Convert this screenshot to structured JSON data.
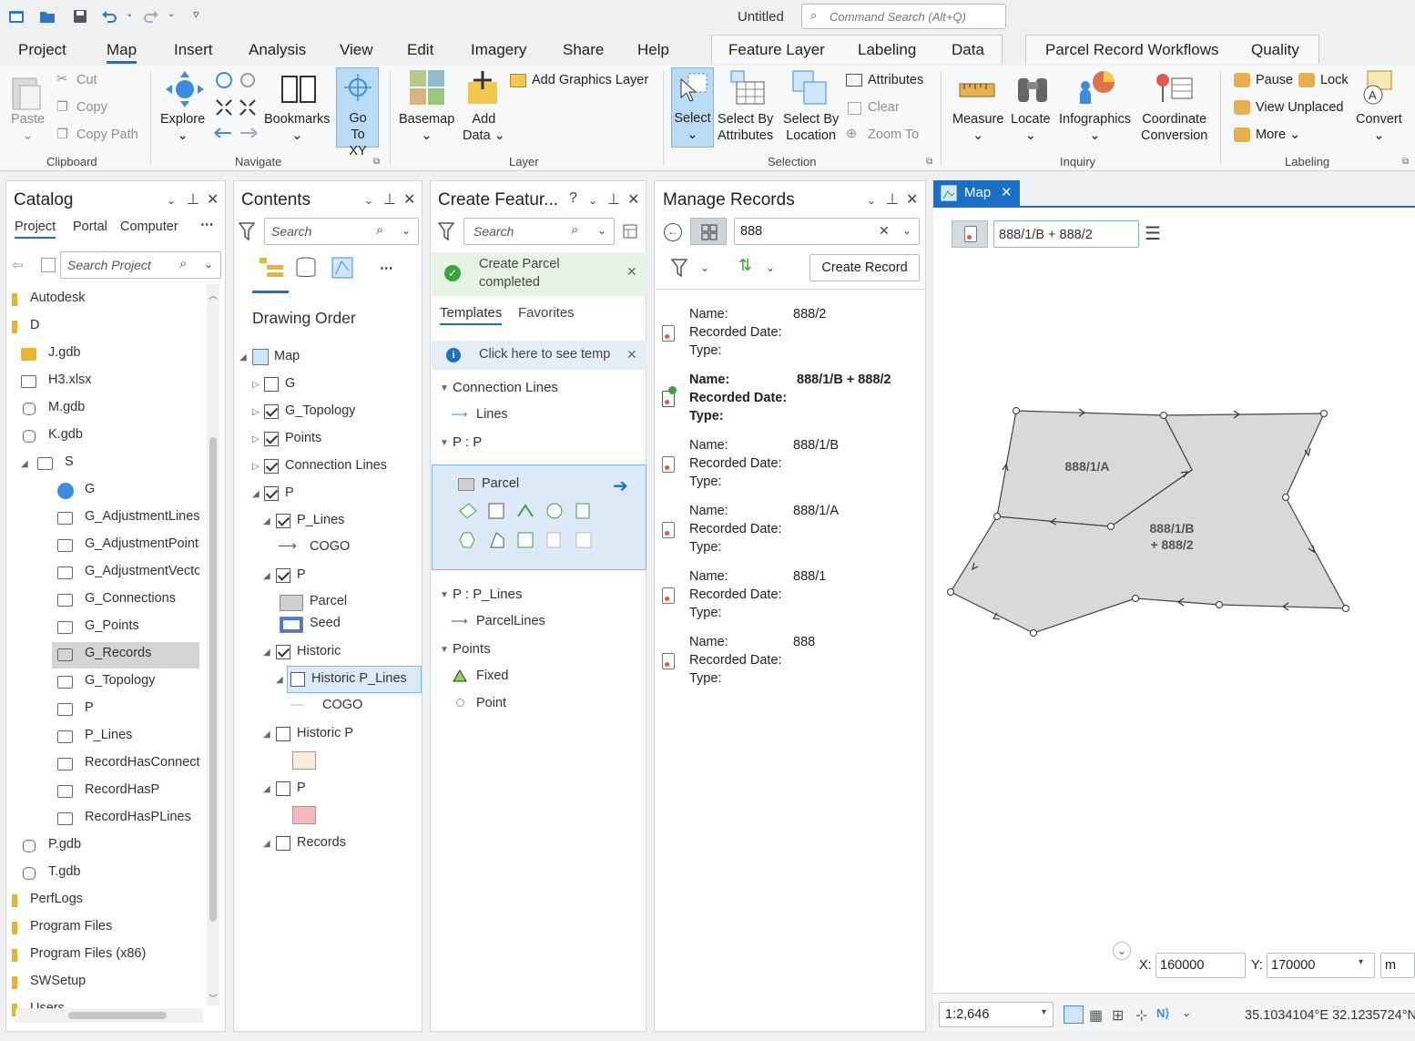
{
  "title_bar": {
    "doc_title": "Untitled",
    "command_search_placeholder": "Command Search (Alt+Q)"
  },
  "tabs": [
    "Project",
    "Map",
    "Insert",
    "Analysis",
    "View",
    "Edit",
    "Imagery",
    "Share",
    "Help"
  ],
  "context_tabs": [
    "Feature Layer",
    "Labeling",
    "Data"
  ],
  "context_tabs2": [
    "Parcel Record Workflows",
    "Quality"
  ],
  "ribbon": {
    "clipboard": {
      "paste": "Paste",
      "cut": "Cut",
      "copy": "Copy",
      "copy_path": "Copy Path",
      "group": "Clipboard"
    },
    "navigate": {
      "explore": "Explore",
      "bookmarks": "Bookmarks",
      "goto1": "Go",
      "goto2": "To XY",
      "group": "Navigate"
    },
    "layer": {
      "basemap": "Basemap",
      "add_data1": "Add",
      "add_data2": "Data",
      "add_graphics": "Add Graphics Layer",
      "group": "Layer"
    },
    "selection": {
      "select": "Select",
      "sba1": "Select By",
      "sba2": "Attributes",
      "sbl1": "Select By",
      "sbl2": "Location",
      "attributes": "Attributes",
      "clear": "Clear",
      "zoom_to": "Zoom To",
      "group": "Selection"
    },
    "inquiry": {
      "measure": "Measure",
      "locate": "Locate",
      "infographics": "Infographics",
      "coord1": "Coordinate",
      "coord2": "Conversion",
      "group": "Inquiry"
    },
    "labeling": {
      "pause": "Pause",
      "lock": "Lock",
      "view_unplaced": "View Unplaced",
      "more": "More",
      "convert": "Convert",
      "group": "Labeling"
    }
  },
  "catalog": {
    "title": "Catalog",
    "tabs": [
      "Project",
      "Portal",
      "Computer"
    ],
    "search_placeholder": "Search Project",
    "items": [
      "Autodesk",
      "D",
      "J.gdb",
      "H3.xlsx",
      "M.gdb",
      "K.gdb",
      "S",
      "G",
      "G_AdjustmentLines",
      "G_AdjustmentPoints",
      "G_AdjustmentVecto",
      "G_Connections",
      "G_Points",
      "G_Records",
      "G_Topology",
      "P",
      "P_Lines",
      "RecordHasConnecti",
      "RecordHasP",
      "RecordHasPLines",
      "P.gdb",
      "T.gdb",
      "PerfLogs",
      "Program Files",
      "Program Files (x86)",
      "SWSetup",
      "Users"
    ]
  },
  "contents": {
    "title": "Contents",
    "search_placeholder": "Search",
    "drawing_order": "Drawing Order",
    "items": [
      "Map",
      "G",
      "G_Topology",
      "Points",
      "Connection Lines",
      "P",
      "P_Lines",
      "COGO",
      "P",
      "Parcel",
      "Seed",
      "Historic",
      "Historic P_Lines",
      "COGO",
      "Historic P",
      "P",
      "Records"
    ]
  },
  "create_features": {
    "title": "Create Featur...",
    "search_placeholder": "Search",
    "msg1": "Create Parcel",
    "msg2": "completed",
    "tabs": [
      "Templates",
      "Favorites"
    ],
    "info": "Click here to see temp",
    "groups": {
      "g1": "Connection Lines",
      "g1i": "Lines",
      "g2": "P : P",
      "g2i": "Parcel",
      "g3": "P : P_Lines",
      "g3i": "ParcelLines",
      "g4": "Points",
      "g4i1": "Fixed",
      "g4i2": "Point"
    }
  },
  "manage_records": {
    "title": "Manage Records",
    "search_value": "888",
    "create_button": "Create Record",
    "labels": {
      "name": "Name:",
      "date": "Recorded Date:",
      "type": "Type:"
    },
    "records": [
      {
        "name": "888/2",
        "date": "",
        "type": ""
      },
      {
        "name": "888/1/B + 888/2",
        "date": "",
        "type": ""
      },
      {
        "name": "888/1/B",
        "date": "",
        "type": ""
      },
      {
        "name": "888/1/A",
        "date": "",
        "type": ""
      },
      {
        "name": "888/1",
        "date": "",
        "type": ""
      },
      {
        "name": "888",
        "date": "",
        "type": ""
      }
    ]
  },
  "map": {
    "tab": "Map",
    "active_record": "888/1/B + 888/2",
    "label_a": "888/1/A",
    "label_b1": "888/1/B",
    "label_b2": "+ 888/2",
    "x_label": "X:",
    "x_value": "160000",
    "y_label": "Y:",
    "y_value": "170000",
    "unit": "m",
    "scale": "1:2,646",
    "coords": "35.1034104°E 32.1235724°N"
  },
  "colors": {
    "accent": "#1c6fc7",
    "select_bg": "#b9dcf4",
    "parcel_fill": "#d9d9d9"
  }
}
